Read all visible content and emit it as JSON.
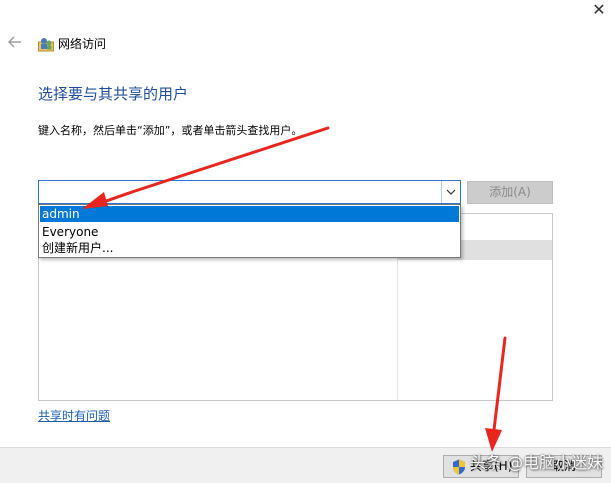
{
  "window": {
    "close_glyph": "✕",
    "back_icon": "back-arrow-icon",
    "app_icon": "network-users-icon",
    "title": "网络访问"
  },
  "main": {
    "heading": "选择要与其共享的用户",
    "instructions": "键入名称，然后单击“添加”，或者单击箭头查找用户。"
  },
  "user_combo": {
    "value": "",
    "dropdown_icon": "chevron-down-icon",
    "add_label": "添加(A)",
    "options": [
      "admin",
      "Everyone",
      "创建新用户..."
    ],
    "selected_index": 0
  },
  "links": {
    "help": "共享时有问题"
  },
  "footer": {
    "share_label": "共享(H)",
    "cancel_label": "取消"
  },
  "watermark": {
    "text": "头条 @电脑小迷妹"
  },
  "colors": {
    "heading": "#1f4e9c",
    "selection": "#0078d7",
    "arrow": "#e8261e",
    "link": "#1a5fb4"
  }
}
